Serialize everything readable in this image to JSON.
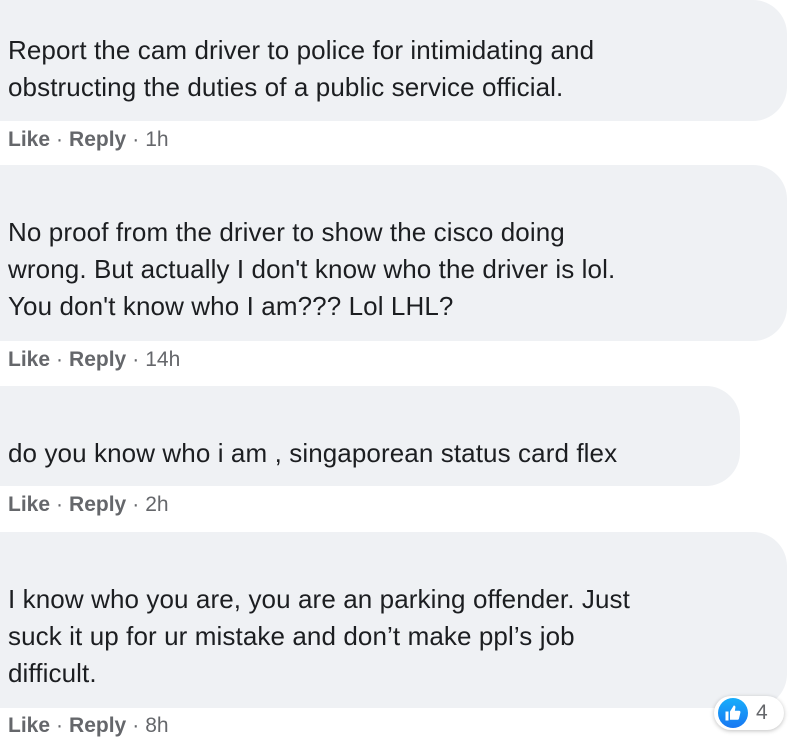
{
  "comments": [
    {
      "text": "Report the cam driver to police for intimidating and\nobstructing the duties of a public service official.",
      "like_label": "Like",
      "separator": "·",
      "reply_label": "Reply",
      "time": "1h"
    },
    {
      "text": "No proof from the driver to show the cisco doing\nwrong. But actually I don't know who the driver is lol.\nYou don't know who I am??? Lol LHL?",
      "like_label": "Like",
      "separator": "·",
      "reply_label": "Reply",
      "time": "14h"
    },
    {
      "text": "do you know who i am , singaporean status card flex",
      "like_label": "Like",
      "separator": "·",
      "reply_label": "Reply",
      "time": "2h"
    },
    {
      "text": "I know who you are, you are an parking offender. Just\nsuck it up for ur mistake and don’t make ppl’s job\ndifficult.",
      "like_label": "Like",
      "separator": "·",
      "reply_label": "Reply",
      "time": "8h"
    }
  ],
  "reaction": {
    "icon": "thumbs-up-icon",
    "count": "4",
    "color": "#1877f2"
  }
}
